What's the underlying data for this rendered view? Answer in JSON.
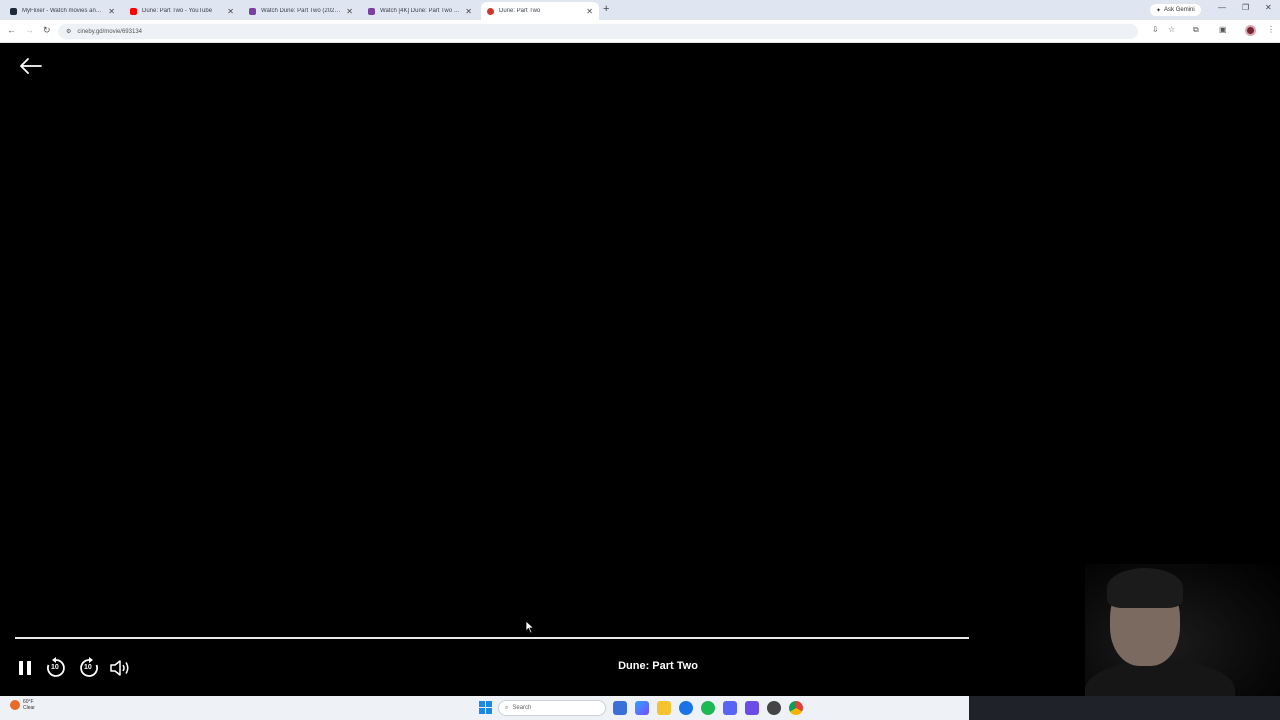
{
  "browser": {
    "tabs": [
      {
        "title": "MyFlixer - Watch movies and S...",
        "favicon_color": "#1e2a3a",
        "active": false
      },
      {
        "title": "Dune: Part Two - YouTube",
        "favicon_color": "#ff0000",
        "active": false
      },
      {
        "title": "Watch Dune: Part Two (2024) Fr...",
        "favicon_color": "#7b3fa0",
        "active": false
      },
      {
        "title": "Watch [4K] Dune: Part Two (202...",
        "favicon_color": "#7b3fa0",
        "active": false
      },
      {
        "title": "Dune: Part Two",
        "favicon_color": "#d0342c",
        "active": true
      }
    ],
    "gemini_label": "Ask Gemini",
    "url": "cineby.gd/movie/693134"
  },
  "player": {
    "movie_title": "Dune: Part Two",
    "progress_fraction": 1.0,
    "controls": {
      "pause": "pause-icon",
      "rewind": "rewind-10-icon",
      "forward": "forward-10-icon",
      "volume": "volume-icon",
      "rewind_seconds": "10",
      "forward_seconds": "10"
    }
  },
  "taskbar": {
    "weather_temp": "60°F",
    "weather_cond": "Clear",
    "search_placeholder": "Search"
  },
  "colors": {
    "background": "#000000",
    "progress_fill": "#e8e8e8",
    "progress_track": "#5a5a5a"
  }
}
